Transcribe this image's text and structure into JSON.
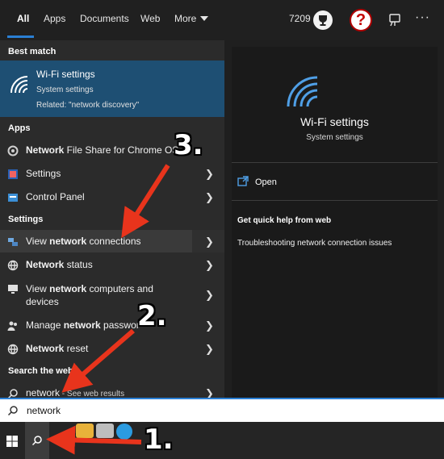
{
  "tabs": [
    {
      "label": "All",
      "active": true
    },
    {
      "label": "Apps"
    },
    {
      "label": "Documents"
    },
    {
      "label": "Web"
    },
    {
      "label": "More"
    }
  ],
  "header": {
    "points": "7209",
    "help_glyph": "?",
    "more_glyph": "···"
  },
  "sections": {
    "best_match": "Best match",
    "apps": "Apps",
    "settings": "Settings",
    "search_web": "Search the web"
  },
  "best_match": {
    "title": "Wi-Fi settings",
    "subtitle": "System settings",
    "related": "Related: \"network discovery\""
  },
  "apps": [
    {
      "bold": "Network",
      "rest": " File Share for Chrome OS"
    },
    {
      "bold": "",
      "rest": "Settings"
    },
    {
      "bold": "",
      "rest": "Control Panel"
    }
  ],
  "settings_items": [
    {
      "pre": "View ",
      "bold": "network",
      "post": " connections"
    },
    {
      "pre": "",
      "bold": "Network",
      "post": " status"
    },
    {
      "pre": "View ",
      "bold": "network",
      "post": " computers and devices"
    },
    {
      "pre": "Manage ",
      "bold": "network",
      "post": " passwor"
    },
    {
      "pre": "",
      "bold": "Network",
      "post": " reset"
    }
  ],
  "web_item": {
    "term": "network",
    "suffix": " - See web results"
  },
  "preview": {
    "title": "Wi-Fi settings",
    "subtitle": "System settings",
    "open": "Open",
    "quick_help": "Get quick help from web",
    "link": "Troubleshooting network connection issues"
  },
  "search": {
    "value": "network"
  },
  "annotations": {
    "step1": "1.",
    "step2": "2.",
    "step3": "3."
  },
  "colors": {
    "accent": "#2a7fd4",
    "best_match_bg": "#1e4f73",
    "arrow": "#e8341c"
  }
}
